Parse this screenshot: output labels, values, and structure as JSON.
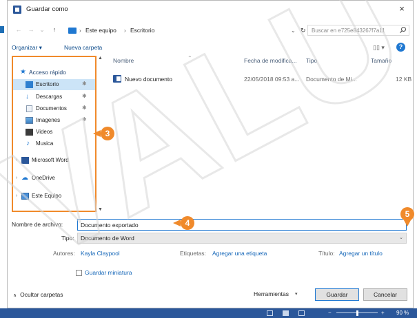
{
  "window": {
    "title": "Guardar como",
    "close_glyph": "×"
  },
  "address": {
    "crumbs": [
      "Este equipo",
      "Escritorio"
    ],
    "separator": "›",
    "search_placeholder": "Buscar en e725e843267f7a11"
  },
  "toolbar": {
    "organize": "Organizar ▾",
    "new_folder": "Nueva carpeta",
    "view": "▯▯ ▾",
    "help": "?"
  },
  "nav": {
    "items": [
      {
        "label": "Acceso rápido",
        "icon": "star-icon"
      },
      {
        "label": "Escritorio",
        "icon": "desktop-folder-icon",
        "pin": "✱"
      },
      {
        "label": "Descargas",
        "icon": "download-icon",
        "pin": "✱"
      },
      {
        "label": "Documentos",
        "icon": "documents-icon",
        "pin": "✱"
      },
      {
        "label": "Imagenes",
        "icon": "pictures-icon",
        "pin": "✱"
      },
      {
        "label": "Videos",
        "icon": "videos-icon"
      },
      {
        "label": "Musica",
        "icon": "music-icon"
      },
      {
        "label": "Microsoft Word",
        "icon": "word-icon"
      },
      {
        "label": "OneDrive",
        "icon": "onedrive-icon"
      },
      {
        "label": "Este Equipo",
        "icon": "computer-icon"
      }
    ]
  },
  "files": {
    "columns": [
      "Nombre",
      "Fecha de modifica...",
      "Tipo",
      "Tamaño"
    ],
    "rows": [
      {
        "name": "Nuevo documento",
        "date": "22/05/2018 09:53 a...",
        "type": "Documento de Mi...",
        "size": "12 KB"
      }
    ]
  },
  "form": {
    "filename_label": "Nombre de archivo:",
    "filename_value": "Documento exportado",
    "type_label": "Tipo:",
    "type_value": "Documento de Word",
    "authors_label": "Autores:",
    "authors_value": "Kayla Claypool",
    "tags_label": "Etiquetas:",
    "tags_value": "Agregar una etiqueta",
    "title_label": "Título:",
    "title_value": "Agregar un título",
    "thumbnail_label": "Guardar miniatura"
  },
  "footer": {
    "hide_folders": "Ocultar carpetas",
    "tools": "Herramientas",
    "save": "Guardar",
    "cancel": "Cancelar"
  },
  "callouts": [
    "3",
    "4",
    "5"
  ],
  "statusbar": {
    "zoom": "90 %"
  },
  "colors": {
    "accent": "#1f78d1",
    "callout": "#f08a2b",
    "word_blue": "#2b579a"
  }
}
